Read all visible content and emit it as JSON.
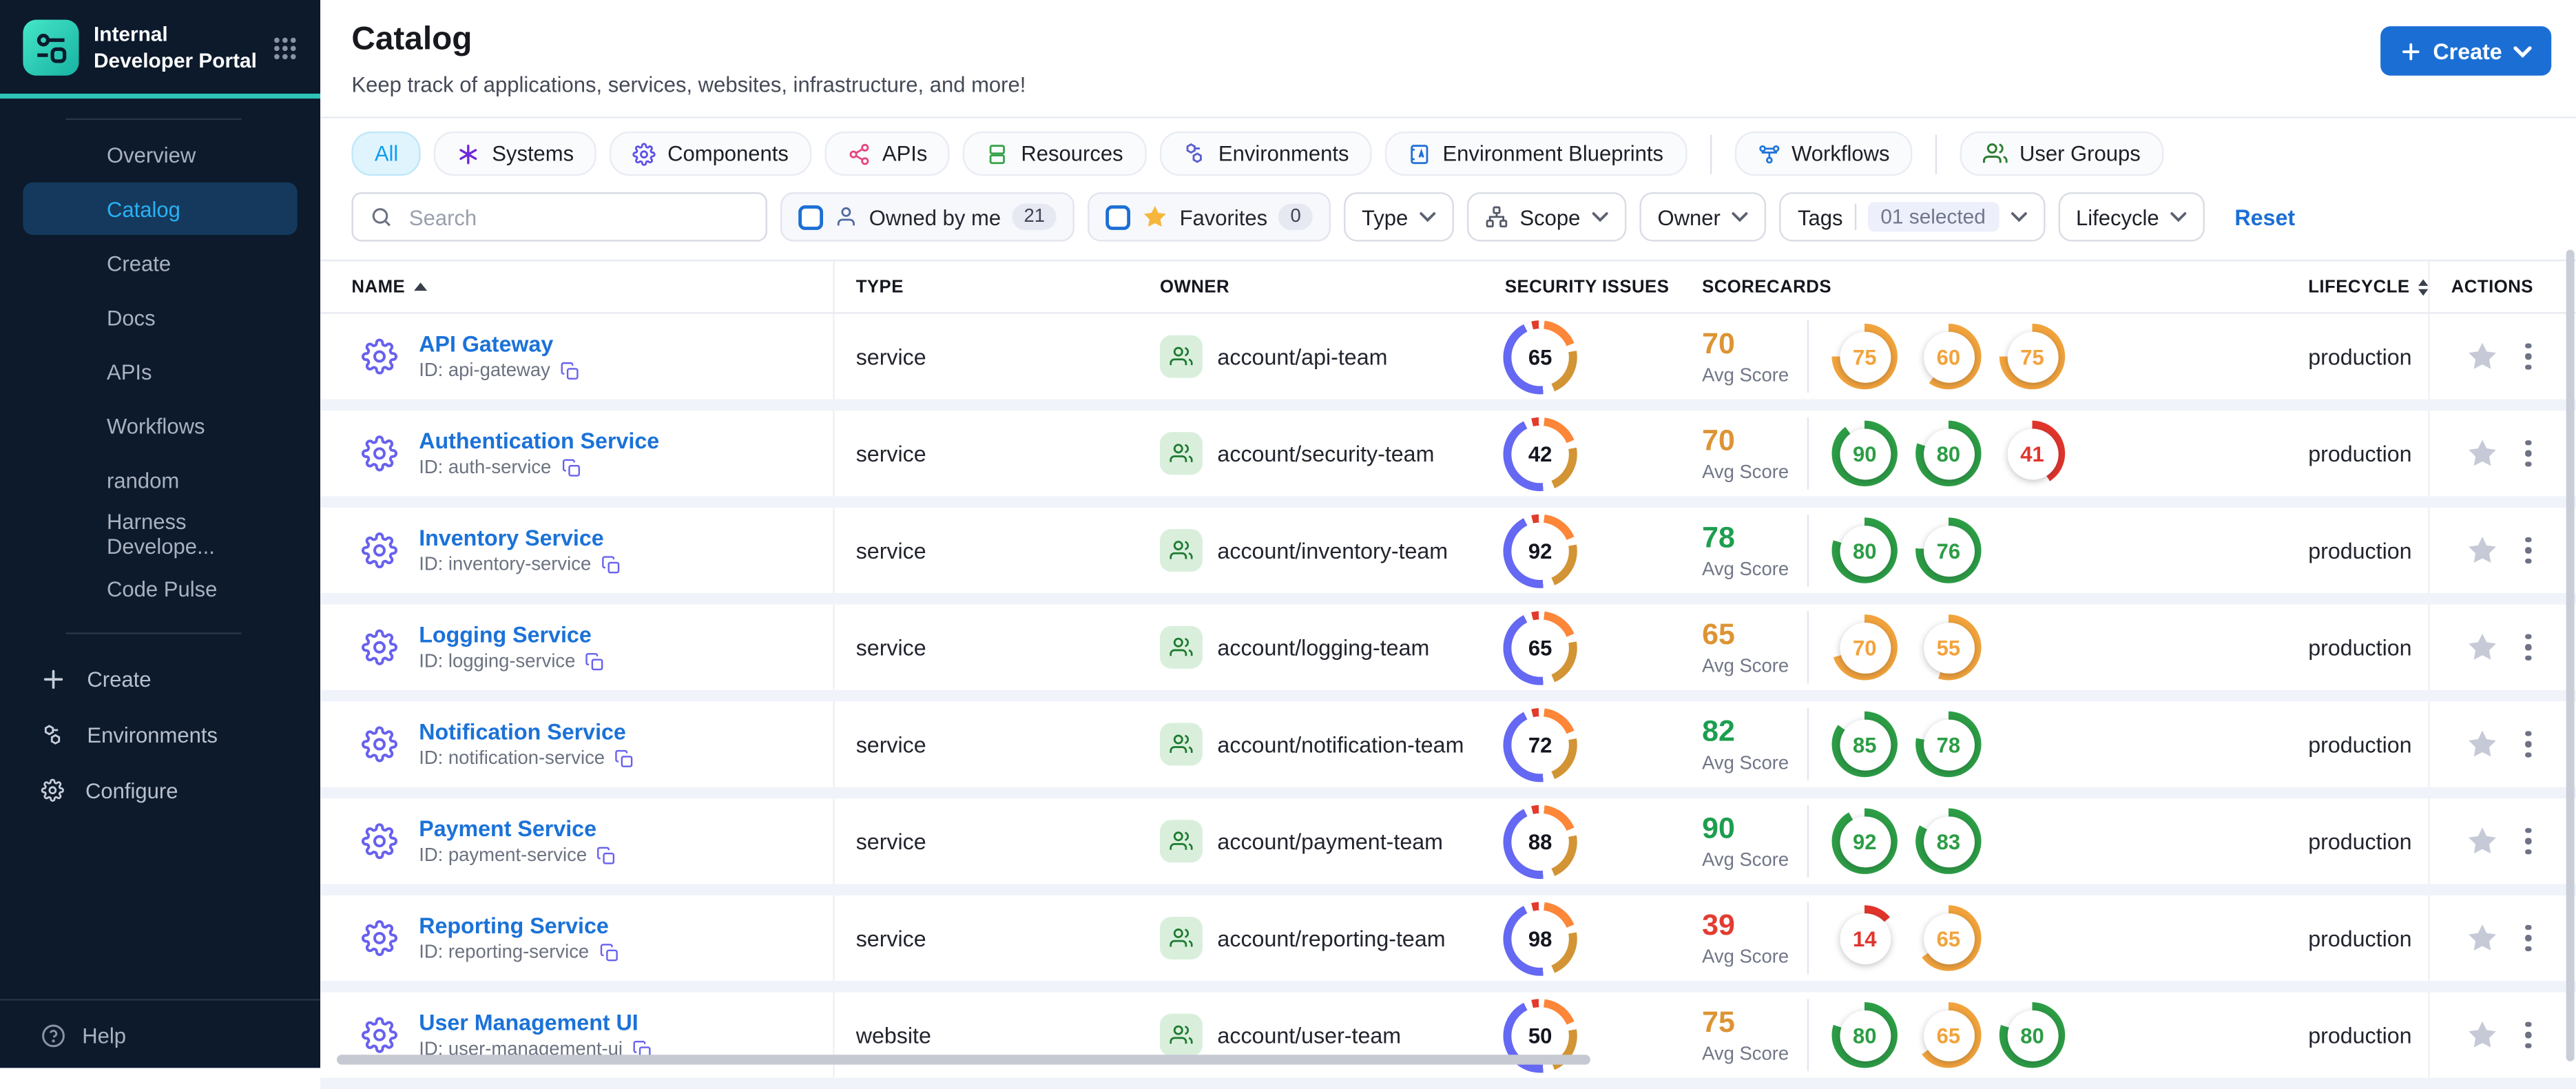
{
  "app": {
    "title": "Internal Developer Portal"
  },
  "sidebar": {
    "items": [
      {
        "label": "Overview",
        "active": false
      },
      {
        "label": "Catalog",
        "active": true
      },
      {
        "label": "Create",
        "active": false
      },
      {
        "label": "Docs",
        "active": false
      },
      {
        "label": "APIs",
        "active": false
      },
      {
        "label": "Workflows",
        "active": false
      },
      {
        "label": "random",
        "active": false
      },
      {
        "label": "Harness Develope...",
        "active": false
      },
      {
        "label": "Code Pulse",
        "active": false
      }
    ],
    "footer_items": [
      {
        "label": "Create",
        "icon": "plus"
      },
      {
        "label": "Environments",
        "icon": "hexagons"
      },
      {
        "label": "Configure",
        "icon": "gear"
      }
    ],
    "help_label": "Help"
  },
  "header": {
    "title": "Catalog",
    "subtitle": "Keep track of applications, services, websites, infrastructure, and more!",
    "create_label": "Create"
  },
  "tabs": [
    {
      "label": "All",
      "icon": null,
      "color": null,
      "active": true,
      "divider_after": false
    },
    {
      "label": "Systems",
      "icon": "asterisk",
      "color": "#6d28d9",
      "active": false,
      "divider_after": false
    },
    {
      "label": "Components",
      "icon": "gear",
      "color": "#5b50e6",
      "active": false,
      "divider_after": false
    },
    {
      "label": "APIs",
      "icon": "api",
      "color": "#e8457c",
      "active": false,
      "divider_after": false
    },
    {
      "label": "Resources",
      "icon": "stack",
      "color": "#37a24a",
      "active": false,
      "divider_after": false
    },
    {
      "label": "Environments",
      "icon": "hexagons",
      "color": "#5a5fd1",
      "active": false,
      "divider_after": false
    },
    {
      "label": "Environment Blueprints",
      "icon": "blueprint",
      "color": "#1f6fd6",
      "active": false,
      "divider_after": true
    },
    {
      "label": "Workflows",
      "icon": "workflow",
      "color": "#2076d8",
      "active": false,
      "divider_after": true
    },
    {
      "label": "User Groups",
      "icon": "people",
      "color": "#2e7d32",
      "active": false,
      "divider_after": false
    }
  ],
  "filters": {
    "search_placeholder": "Search",
    "owned_by_me": {
      "label": "Owned by me",
      "count": "21"
    },
    "favorites": {
      "label": "Favorites",
      "count": "0"
    },
    "type": {
      "label": "Type"
    },
    "scope": {
      "label": "Scope"
    },
    "owner": {
      "label": "Owner"
    },
    "tags": {
      "label": "Tags",
      "selected": "01 selected"
    },
    "lifecycle": {
      "label": "Lifecycle"
    },
    "reset_label": "Reset"
  },
  "table": {
    "columns": [
      "NAME",
      "TYPE",
      "OWNER",
      "SECURITY ISSUES",
      "SCORECARDS",
      "LIFECYCLE",
      "ACTIONS"
    ],
    "avg_label": "Avg Score",
    "rows": [
      {
        "name": "API Gateway",
        "id": "ID: api-gateway",
        "type": "service",
        "owner": "account/api-team",
        "security": 65,
        "avg": "70",
        "avg_tone": "amber",
        "scorecards": [
          {
            "value": 75,
            "tone": "amber"
          },
          {
            "value": 60,
            "tone": "amber"
          },
          {
            "value": 75,
            "tone": "amber"
          }
        ],
        "lifecycle": "production"
      },
      {
        "name": "Authentication Service",
        "id": "ID: auth-service",
        "type": "service",
        "owner": "account/security-team",
        "security": 42,
        "avg": "70",
        "avg_tone": "amber",
        "scorecards": [
          {
            "value": 90,
            "tone": "green"
          },
          {
            "value": 80,
            "tone": "green"
          },
          {
            "value": 41,
            "tone": "red"
          }
        ],
        "lifecycle": "production"
      },
      {
        "name": "Inventory Service",
        "id": "ID: inventory-service",
        "type": "service",
        "owner": "account/inventory-team",
        "security": 92,
        "avg": "78",
        "avg_tone": "green",
        "scorecards": [
          {
            "value": 80,
            "tone": "green"
          },
          {
            "value": 76,
            "tone": "green"
          }
        ],
        "lifecycle": "production"
      },
      {
        "name": "Logging Service",
        "id": "ID: logging-service",
        "type": "service",
        "owner": "account/logging-team",
        "security": 65,
        "avg": "65",
        "avg_tone": "amber",
        "scorecards": [
          {
            "value": 70,
            "tone": "amber"
          },
          {
            "value": 55,
            "tone": "amber"
          }
        ],
        "lifecycle": "production"
      },
      {
        "name": "Notification Service",
        "id": "ID: notification-service",
        "type": "service",
        "owner": "account/notification-team",
        "security": 72,
        "avg": "82",
        "avg_tone": "green",
        "scorecards": [
          {
            "value": 85,
            "tone": "green"
          },
          {
            "value": 78,
            "tone": "green"
          }
        ],
        "lifecycle": "production"
      },
      {
        "name": "Payment Service",
        "id": "ID: payment-service",
        "type": "service",
        "owner": "account/payment-team",
        "security": 88,
        "avg": "90",
        "avg_tone": "green",
        "scorecards": [
          {
            "value": 92,
            "tone": "green"
          },
          {
            "value": 83,
            "tone": "green"
          }
        ],
        "lifecycle": "production"
      },
      {
        "name": "Reporting Service",
        "id": "ID: reporting-service",
        "type": "service",
        "owner": "account/reporting-team",
        "security": 98,
        "avg": "39",
        "avg_tone": "red",
        "scorecards": [
          {
            "value": 14,
            "tone": "red"
          },
          {
            "value": 65,
            "tone": "amber"
          }
        ],
        "lifecycle": "production"
      },
      {
        "name": "User Management UI",
        "id": "ID: user-management-ui",
        "type": "website",
        "owner": "account/user-team",
        "security": 50,
        "avg": "75",
        "avg_tone": "amber",
        "scorecards": [
          {
            "value": 80,
            "tone": "green"
          },
          {
            "value": 65,
            "tone": "amber"
          },
          {
            "value": 80,
            "tone": "green"
          }
        ],
        "lifecycle": "production"
      }
    ]
  },
  "theme": {
    "primary_blue": "#1b6fd4",
    "teal_accent": "#2ec5b6",
    "tones": {
      "green": "#2c9d45",
      "amber": "#f2a33c",
      "red": "#e1352c"
    },
    "donut_segments": [
      "#e23b2c",
      "#fd8638",
      "#d29434",
      "#6468f2"
    ]
  }
}
